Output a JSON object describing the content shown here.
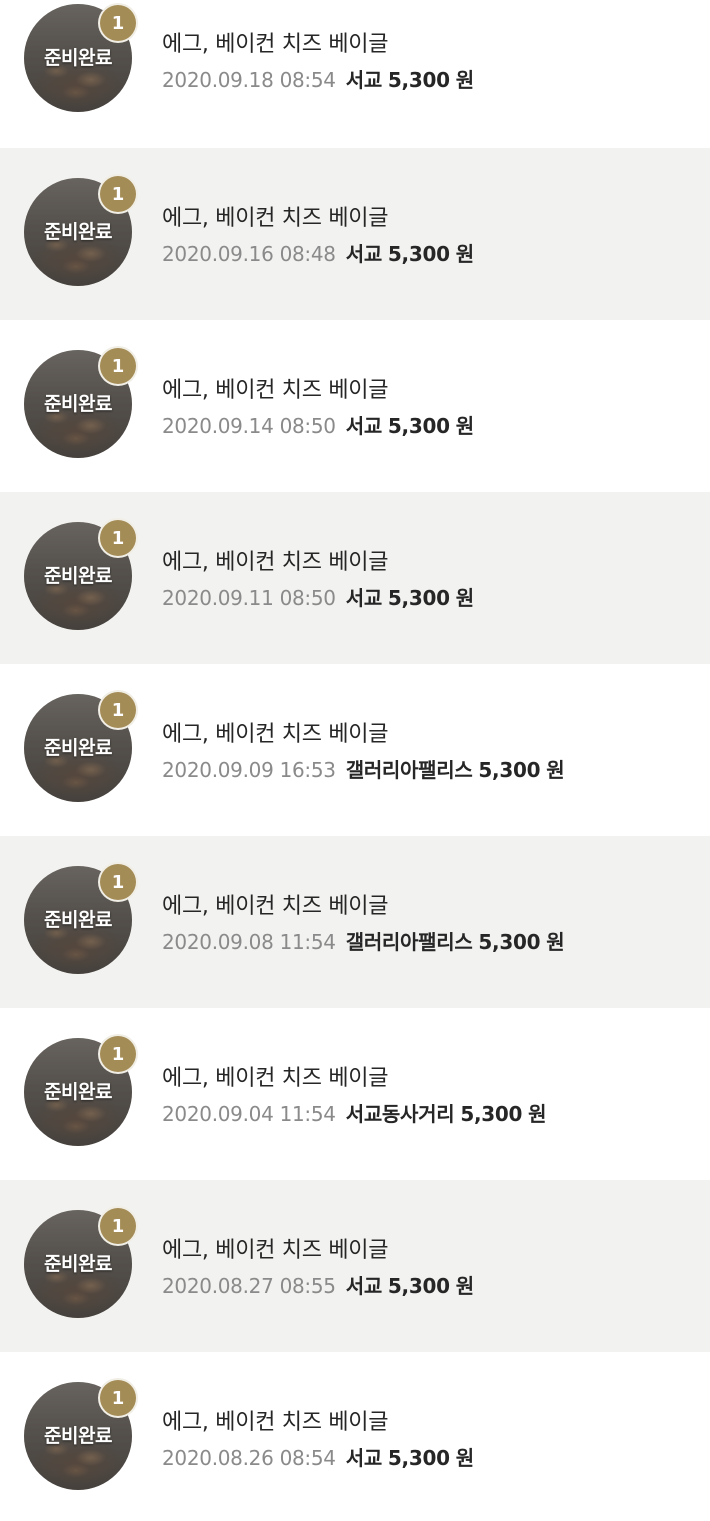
{
  "orders": [
    {
      "status": "준비완료",
      "badge": "1",
      "item": "에그, 베이컨 치즈 베이글",
      "datetime": "2020.09.18 08:54",
      "store": "서교",
      "price": "5,300",
      "currency": "원"
    },
    {
      "status": "준비완료",
      "badge": "1",
      "item": "에그, 베이컨 치즈 베이글",
      "datetime": "2020.09.16 08:48",
      "store": "서교",
      "price": "5,300",
      "currency": "원"
    },
    {
      "status": "준비완료",
      "badge": "1",
      "item": "에그, 베이컨 치즈 베이글",
      "datetime": "2020.09.14 08:50",
      "store": "서교",
      "price": "5,300",
      "currency": "원"
    },
    {
      "status": "준비완료",
      "badge": "1",
      "item": "에그, 베이컨 치즈 베이글",
      "datetime": "2020.09.11 08:50",
      "store": "서교",
      "price": "5,300",
      "currency": "원"
    },
    {
      "status": "준비완료",
      "badge": "1",
      "item": "에그, 베이컨 치즈 베이글",
      "datetime": "2020.09.09 16:53",
      "store": "갤러리아팰리스",
      "price": "5,300",
      "currency": "원"
    },
    {
      "status": "준비완료",
      "badge": "1",
      "item": "에그, 베이컨 치즈 베이글",
      "datetime": "2020.09.08 11:54",
      "store": "갤러리아팰리스",
      "price": "5,300",
      "currency": "원"
    },
    {
      "status": "준비완료",
      "badge": "1",
      "item": "에그, 베이컨 치즈 베이글",
      "datetime": "2020.09.04 11:54",
      "store": "서교동사거리",
      "price": "5,300",
      "currency": "원"
    },
    {
      "status": "준비완료",
      "badge": "1",
      "item": "에그, 베이컨 치즈 베이글",
      "datetime": "2020.08.27 08:55",
      "store": "서교",
      "price": "5,300",
      "currency": "원"
    },
    {
      "status": "준비완료",
      "badge": "1",
      "item": "에그, 베이컨 치즈 베이글",
      "datetime": "2020.08.26 08:54",
      "store": "서교",
      "price": "5,300",
      "currency": "원"
    }
  ],
  "colors": {
    "badge": "#a48c57",
    "row_alt_background": "#f2f2f0",
    "datetime_text": "#8a8a8a",
    "primary_text": "#262626"
  },
  "icons": {
    "thumbnail": "product-thumbnail-image",
    "badge": "quantity-badge"
  }
}
